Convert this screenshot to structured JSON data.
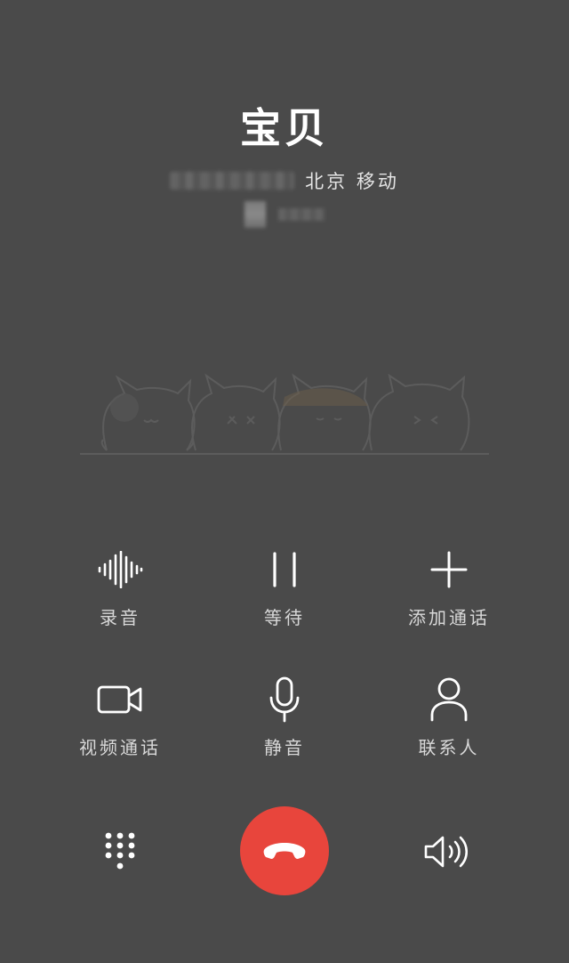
{
  "caller": {
    "name": "宝贝",
    "location": "北京 移动"
  },
  "actions": {
    "record": {
      "label": "录音",
      "icon": "waveform-icon"
    },
    "hold": {
      "label": "等待",
      "icon": "pause-icon"
    },
    "add_call": {
      "label": "添加通话",
      "icon": "plus-icon"
    },
    "video_call": {
      "label": "视频通话",
      "icon": "video-camera-icon"
    },
    "mute": {
      "label": "静音",
      "icon": "microphone-icon"
    },
    "contacts": {
      "label": "联系人",
      "icon": "person-icon"
    }
  },
  "bottom_bar": {
    "keypad_icon": "dialpad-icon",
    "hangup_icon": "phone-hangup-icon",
    "speaker_icon": "speaker-icon"
  },
  "colors": {
    "background": "#4a4a4a",
    "hangup": "#e8453c",
    "text": "#ffffff",
    "label": "#d8d8d8"
  }
}
